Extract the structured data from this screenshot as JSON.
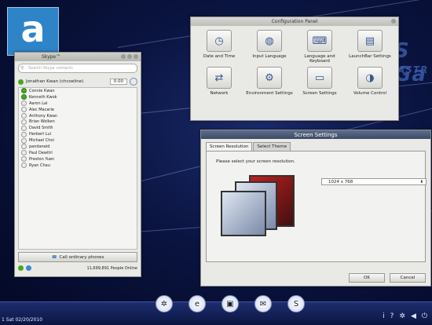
{
  "watermark": {
    "letter": "a"
  },
  "desktop": {
    "brand_fragment": "S Ga",
    "brand_fragment2": "ASTR"
  },
  "skype": {
    "title": "Skype™",
    "search_placeholder": "Search Skype contacts",
    "me": {
      "name": "Jonathan Kwan (chcoeline)",
      "balance": "0.00"
    },
    "contacts": [
      {
        "name": "Connie Kwan",
        "online": true
      },
      {
        "name": "Kenneth Kwok",
        "online": true
      },
      {
        "name": "Aaron Lai",
        "online": false
      },
      {
        "name": "Alec Macarie",
        "online": false
      },
      {
        "name": "Anthony Kwan",
        "online": false
      },
      {
        "name": "Brian Wolken",
        "online": false
      },
      {
        "name": "David Smith",
        "online": false
      },
      {
        "name": "Herbert Lui",
        "online": false
      },
      {
        "name": "Michael Choi",
        "online": false
      },
      {
        "name": "pandaneid",
        "online": false
      },
      {
        "name": "Paul Dewitri",
        "online": false
      },
      {
        "name": "Preston Yuen",
        "online": false
      },
      {
        "name": "Ryan Chau",
        "online": false
      }
    ],
    "call_button": "Call ordinary phones",
    "people_online": "11,699,891 People Online"
  },
  "control_panel": {
    "title": "Configuration Panel",
    "items": [
      {
        "label": "Date and Time",
        "icon": "clock-icon"
      },
      {
        "label": "Input Language",
        "icon": "globe-icon"
      },
      {
        "label": "Language and Keyboard",
        "icon": "keyboard-icon"
      },
      {
        "label": "LaunchBar Settings",
        "icon": "launchbar-icon"
      },
      {
        "label": "Network",
        "icon": "network-icon"
      },
      {
        "label": "Environment Settings",
        "icon": "environment-icon"
      },
      {
        "label": "Screen Settings",
        "icon": "monitor-icon"
      },
      {
        "label": "Volume Control",
        "icon": "speaker-icon"
      }
    ]
  },
  "screen_settings": {
    "title": "Screen Settings",
    "tabs": [
      "Screen Resolution",
      "Select Theme"
    ],
    "prompt": "Please select your screen resolution.",
    "resolution": "1024 x 768",
    "ok": "OK",
    "cancel": "Cancel"
  },
  "taskbar": {
    "clock": "1 Sat 02/20/2010"
  }
}
